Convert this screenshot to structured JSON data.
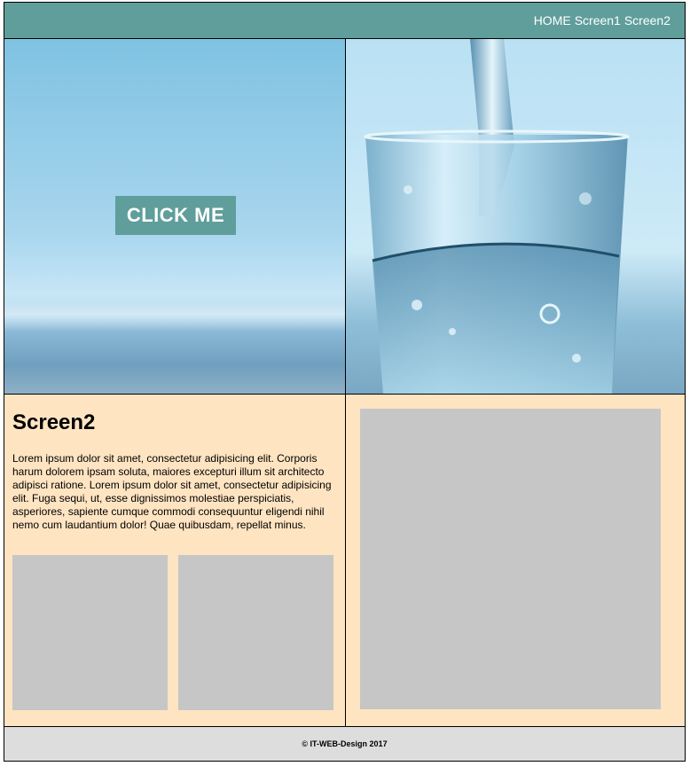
{
  "nav": {
    "links": [
      "HOME",
      "Screen1",
      "Screen2"
    ]
  },
  "hero": {
    "cta_label": "CLICK ME"
  },
  "content": {
    "heading": "Screen2",
    "body": "Lorem ipsum dolor sit amet, consectetur adipisicing elit. Corporis harum dolorem ipsam soluta, maiores excepturi illum sit architecto adipisci ratione. Lorem ipsum dolor sit amet, consectetur adipisicing elit. Fuga sequi, ut, esse dignissimos molestiae perspiciatis, asperiores, sapiente cumque commodi consequuntur eligendi nihil nemo cum laudantium dolor! Quae quibusdam, repellat minus."
  },
  "footer": {
    "text": "© IT-WEB-Design 2017"
  },
  "colors": {
    "nav_bg": "#5f9e9b",
    "content_bg": "#ffe4c2",
    "placeholder": "#c6c6c6",
    "footer_bg": "#dddddd"
  }
}
